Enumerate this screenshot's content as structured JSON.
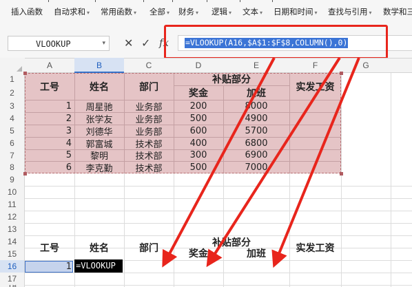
{
  "ribbon": {
    "items": [
      "插入函数",
      "自动求和",
      "常用函数",
      "全部",
      "财务",
      "逻辑",
      "文本",
      "日期和时间",
      "查找与引用",
      "数学和三"
    ],
    "dropdown_glyph": "▾"
  },
  "formula_bar": {
    "name_box": "VLOOKUP",
    "name_box_arrow": "▾",
    "cancel_icon": "✕",
    "confirm_icon": "✓",
    "fx_label": "fx",
    "formula": "=VLOOKUP(A16,$A$1:$F$8,COLUMN(),0)"
  },
  "columns": [
    "A",
    "B",
    "C",
    "D",
    "E",
    "F",
    "G"
  ],
  "active_column": "B",
  "rows": [
    "1",
    "2",
    "3",
    "4",
    "5",
    "6",
    "7",
    "8",
    "9",
    "10",
    "11",
    "12",
    "13",
    "14",
    "15",
    "16",
    "17",
    "18"
  ],
  "active_row": "16",
  "table": {
    "headers": {
      "id": "工号",
      "name": "姓名",
      "dept": "部门",
      "subsidy": "补贴部分",
      "bonus": "奖金",
      "overtime": "加班",
      "salary": "实发工资"
    },
    "records": [
      {
        "id": "1",
        "name": "周星驰",
        "dept": "业务部",
        "bonus": "200",
        "overtime": "8000"
      },
      {
        "id": "2",
        "name": "张学友",
        "dept": "业务部",
        "bonus": "500",
        "overtime": "4900"
      },
      {
        "id": "3",
        "name": "刘德华",
        "dept": "业务部",
        "bonus": "600",
        "overtime": "5700"
      },
      {
        "id": "4",
        "name": "郭富城",
        "dept": "技术部",
        "bonus": "400",
        "overtime": "6800"
      },
      {
        "id": "5",
        "name": "黎明",
        "dept": "技术部",
        "bonus": "300",
        "overtime": "6900"
      },
      {
        "id": "6",
        "name": "李克勤",
        "dept": "技术部",
        "bonus": "500",
        "overtime": "7000"
      }
    ]
  },
  "lookup": {
    "headers": {
      "id": "工号",
      "name": "姓名",
      "dept": "部门",
      "subsidy": "补贴部分",
      "bonus": "奖金",
      "overtime": "加班",
      "salary": "实发工资"
    },
    "id_value": "1",
    "editing_text": "=VLOOKUP"
  },
  "colors": {
    "highlight_border": "#e8251c",
    "table_fill": "#e5c4c6",
    "formula_selection": "#3b74d6",
    "active_header": "#d7e2f3"
  }
}
